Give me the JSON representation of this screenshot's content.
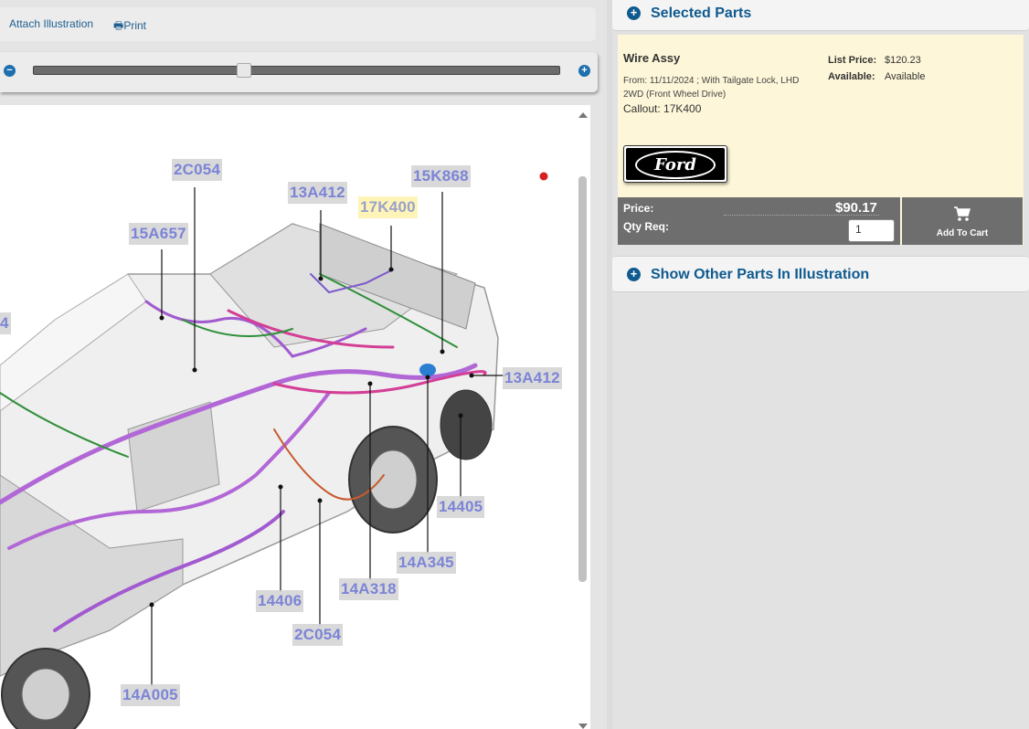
{
  "toolbar": {
    "attach_label": "Attach Illustration",
    "print_label": "Print"
  },
  "zoom": {
    "minus": "−",
    "plus": "+",
    "level": 0.4
  },
  "illustration": {
    "callouts": [
      "2C054",
      "13A412",
      "17K400",
      "15K868",
      "15A657",
      "13A412",
      "14405",
      "14A345",
      "14A318",
      "14406",
      "2C054",
      "14A005",
      "4"
    ],
    "selected_callout": "17K400"
  },
  "selected_parts": {
    "header": "Selected Parts",
    "part_name": "Wire Assy",
    "from_text": "From: 11/11/2024 ; With Tailgate Lock, LHD 2WD (Front Wheel Drive)",
    "callout_text": "Callout: 17K400",
    "list_price_label": "List Price:",
    "list_price": "$120.23",
    "available_label": "Available:",
    "available_value": "Available",
    "brand_logo": "Ford",
    "price_label": "Price:",
    "price": "$90.17",
    "qty_label": "Qty Req:",
    "qty_value": "1",
    "add_to_cart": "Add To Cart"
  },
  "other_parts": {
    "header": "Show Other Parts In Illustration"
  },
  "colors": {
    "accent": "#0f5a8f",
    "callout_text": "#7c84d6",
    "card_bg": "#fdf6d8",
    "price_bar": "#6e6e6e"
  }
}
